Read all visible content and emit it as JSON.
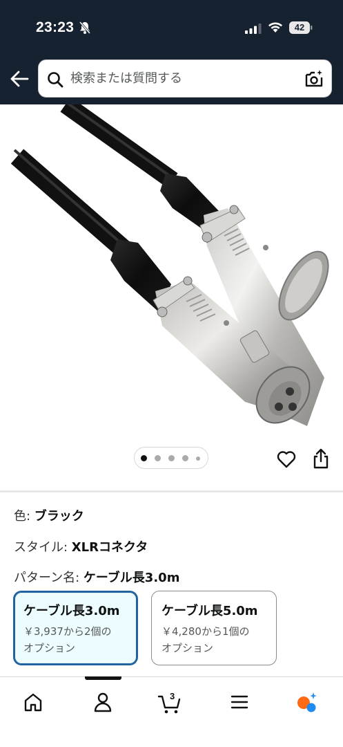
{
  "status_bar": {
    "time": "23:23",
    "battery": "42",
    "icons": [
      "bell-muted-icon",
      "cellular-signal-icon",
      "wifi-icon",
      "battery-icon"
    ]
  },
  "header": {
    "back_icon": "back-arrow-icon",
    "search_placeholder": "検索または質問する",
    "search_icon": "search-icon",
    "camera_icon": "camera-search-icon"
  },
  "product_image": {
    "description_icon": "xlr-cable-image",
    "carousel_total": 5,
    "carousel_active": 1,
    "actions": [
      "heart-icon",
      "share-icon"
    ]
  },
  "variations": {
    "color": {
      "label": "色: ",
      "value": "ブラック"
    },
    "style": {
      "label": "スタイル: ",
      "value": "XLRコネクタ"
    },
    "pattern": {
      "label": "パターン名: ",
      "value": "ケーブル長3.0m"
    },
    "options": [
      {
        "title": "ケーブル長3.0m",
        "price_line": "￥3,937から2個の",
        "suffix": "オプション",
        "selected": true
      },
      {
        "title": "ケーブル長5.0m",
        "price_line": "￥4,280から1個の",
        "suffix": "オプション",
        "selected": false
      }
    ]
  },
  "bottom_nav": {
    "items": [
      "home-icon",
      "account-icon",
      "cart-icon",
      "menu-icon",
      "rufus-icon"
    ],
    "cart_count": "3",
    "active": "account-icon"
  },
  "colors": {
    "header_bg": "#172231",
    "selected_border": "#2162a1",
    "selected_bg": "#edfdff",
    "rufus_orange": "#ff6a13",
    "rufus_blue": "#1f8bf0"
  }
}
